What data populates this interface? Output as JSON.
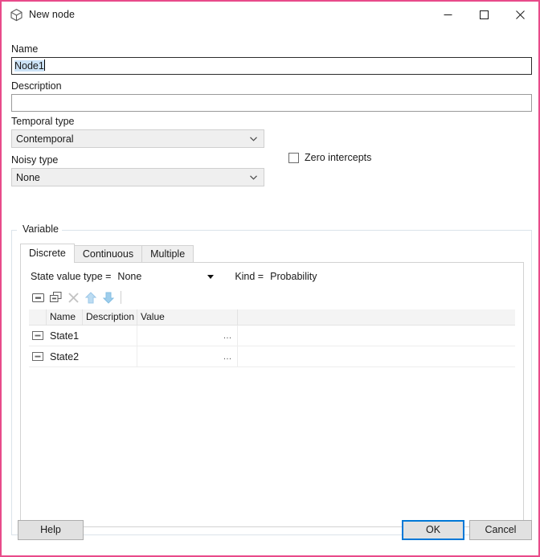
{
  "window": {
    "title": "New node",
    "icon": "cube-icon",
    "border_color": "#e84a8a",
    "minimize_label": "–",
    "maximize_label": "□",
    "close_label": "✕"
  },
  "form": {
    "name_label": "Name",
    "name_value": "Node1",
    "name_selected": true,
    "description_label": "Description",
    "description_value": "",
    "temporal_type_label": "Temporal type",
    "temporal_type_value": "Contemporal",
    "noisy_type_label": "Noisy type",
    "noisy_type_value": "None",
    "zero_intercepts_label": "Zero intercepts",
    "zero_intercepts_checked": false,
    "dropdown_arrow": "⌄"
  },
  "variable_group": {
    "title": "Variable",
    "tabs": [
      {
        "label": "Discrete",
        "active": true
      },
      {
        "label": "Continuous",
        "active": false
      },
      {
        "label": "Multiple",
        "active": false
      }
    ],
    "state_value_type_label": "State value type =",
    "state_value_type_value": "None",
    "state_value_type_arrow": "▾",
    "kind_label": "Kind =",
    "kind_value": "Probability",
    "toolbar": [
      {
        "name": "new-state-icon",
        "glyph": "⊟",
        "enabled": true
      },
      {
        "name": "duplicate-state-icon",
        "glyph": "⧉",
        "enabled": true
      },
      {
        "name": "delete-state-icon",
        "glyph": "✕",
        "enabled": false
      },
      {
        "name": "move-up-icon",
        "glyph": "⇧",
        "enabled": true
      },
      {
        "name": "move-down-icon",
        "glyph": "⇩",
        "enabled": true
      }
    ],
    "grid": {
      "columns": [
        "",
        "Name",
        "Description",
        "Value",
        ""
      ],
      "rows": [
        {
          "icon": "state-icon",
          "name": "State1",
          "description": "",
          "value": "",
          "value_button": "…"
        },
        {
          "icon": "state-icon",
          "name": "State2",
          "description": "",
          "value": "",
          "value_button": "…"
        }
      ]
    }
  },
  "footer": {
    "help_label": "Help",
    "ok_label": "OK",
    "cancel_label": "Cancel"
  }
}
